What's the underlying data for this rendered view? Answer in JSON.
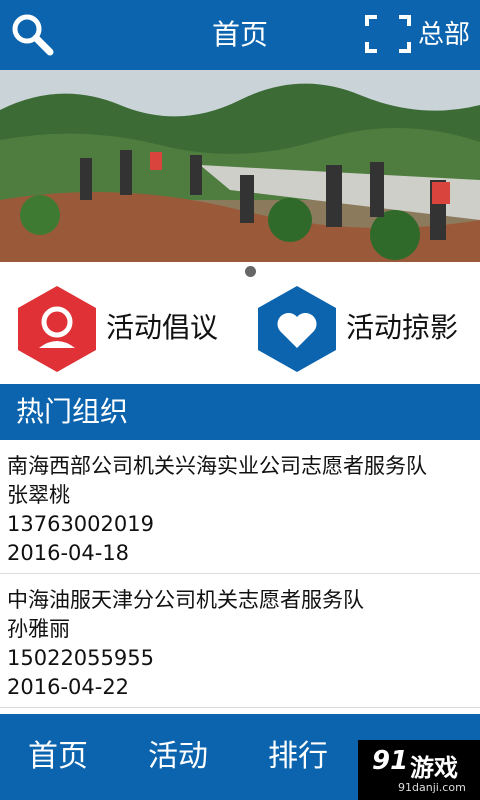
{
  "topbar": {
    "title": "首页",
    "hq_label": "总部",
    "search_icon": "search-icon",
    "scan_icon": "scan-icon"
  },
  "banner": {
    "image": "volunteers-tree-planting-photo",
    "indicator_count": 1
  },
  "quick_actions": [
    {
      "label": "活动倡议",
      "icon": "person-icon",
      "color": "#e03236"
    },
    {
      "label": "活动掠影",
      "icon": "heart-icon",
      "color": "#0b64ad"
    }
  ],
  "section": {
    "title": "热门组织"
  },
  "organizations": [
    {
      "name": "南海西部公司机关兴海实业公司志愿者服务队",
      "contact": "张翠桃",
      "phone": "13763002019",
      "date": "2016-04-18"
    },
    {
      "name": "中海油服天津分公司机关志愿者服务队",
      "contact": "孙雅丽",
      "phone": "15022055955",
      "date": "2016-04-22"
    }
  ],
  "bottom_nav": {
    "tabs": [
      "首页",
      "活动",
      "排行"
    ]
  },
  "watermark": {
    "text": "游戏",
    "logo": "91",
    "url": "91danji.com"
  },
  "colors": {
    "primary": "#0b64ad",
    "accent_red": "#e03236"
  }
}
